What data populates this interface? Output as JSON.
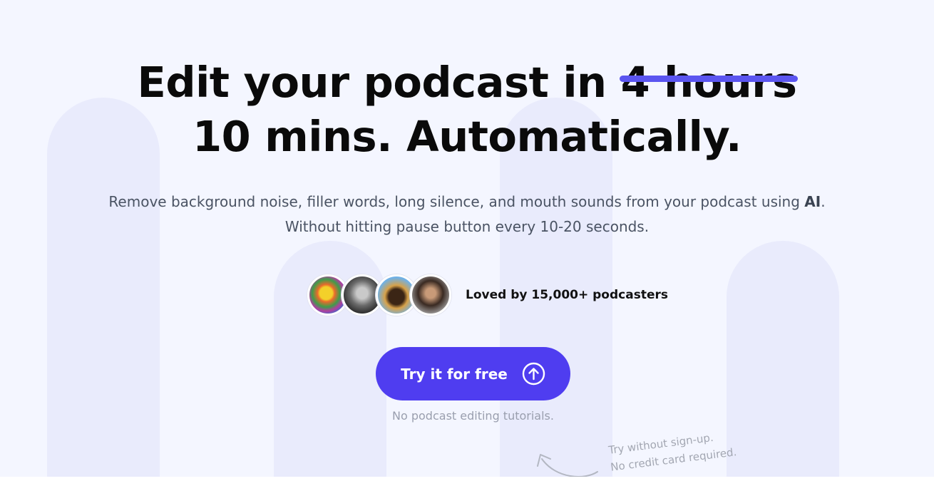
{
  "headline": {
    "line1_prefix": "Edit your podcast in ",
    "struck_text": "4 hours",
    "line2": "10 mins. Automatically."
  },
  "subheadline": {
    "line1_prefix": "Remove background noise, filler words, long silence, and mouth sounds from your podcast using ",
    "line1_bold": "AI",
    "line1_suffix": ".",
    "line2": "Without hitting pause button every 10-20 seconds."
  },
  "social_proof": {
    "text": "Loved by 15,000+ podcasters"
  },
  "cta": {
    "label": "Try it for free",
    "icon": "arrow-up-circle-icon"
  },
  "cta_note": "No podcast editing tutorials.",
  "hand_note": {
    "line1": "Try without sign-up.",
    "line2": "No credit card required."
  },
  "colors": {
    "accent": "#4f3df0",
    "strike": "#5b55f0",
    "background": "#f4f6ff",
    "pillars": "#e9ebfc"
  }
}
